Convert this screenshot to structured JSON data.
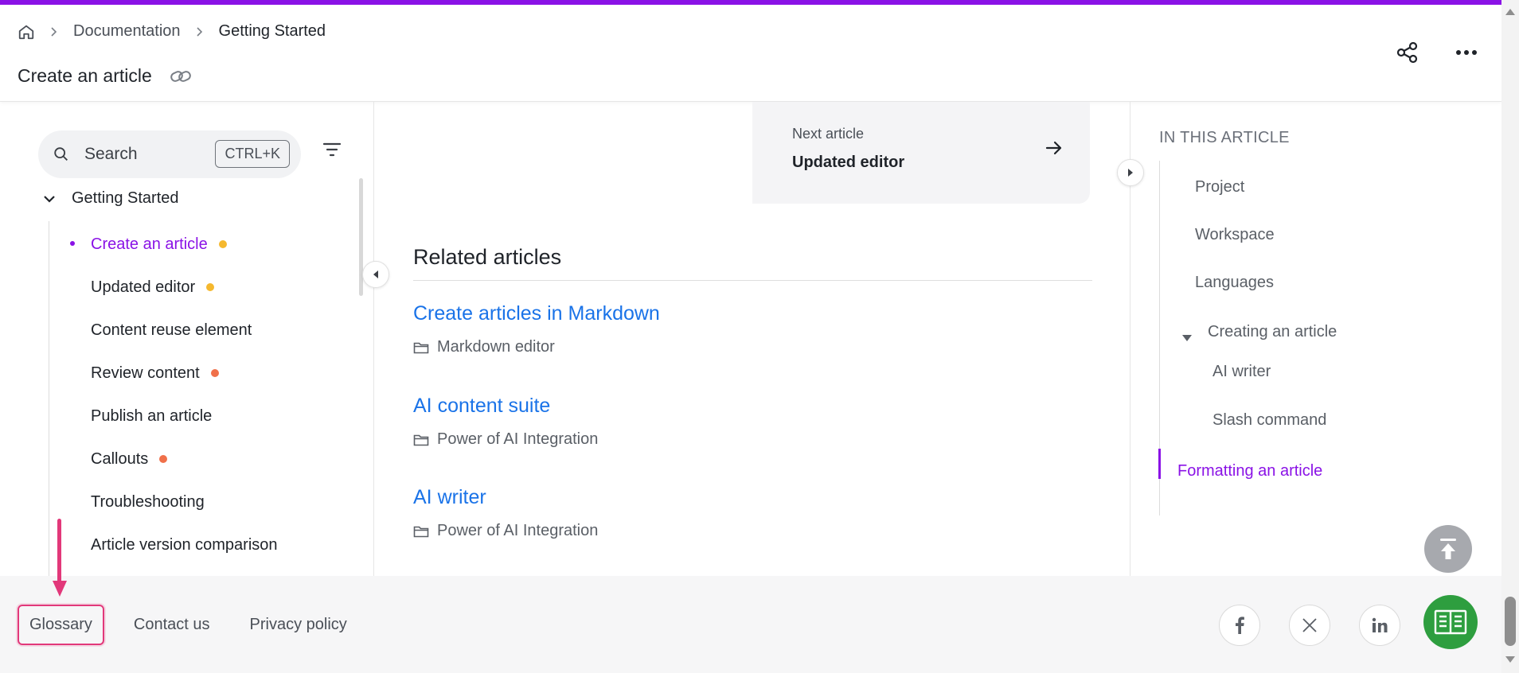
{
  "header": {
    "breadcrumbs": [
      "Documentation",
      "Getting Started"
    ],
    "title": "Create an article"
  },
  "sidebar": {
    "search_label": "Search",
    "search_shortcut": "CTRL+K",
    "section": "Getting Started",
    "items": [
      {
        "label": "Create an article",
        "active": true,
        "dot": "#f5b82e"
      },
      {
        "label": "Updated editor",
        "dot": "#f5b82e"
      },
      {
        "label": "Content reuse element"
      },
      {
        "label": "Review content",
        "dot": "#f0704a"
      },
      {
        "label": "Publish an article"
      },
      {
        "label": "Callouts",
        "dot": "#f0704a"
      },
      {
        "label": "Troubleshooting"
      },
      {
        "label": "Article version comparison"
      }
    ]
  },
  "main": {
    "next_article": {
      "kicker": "Next article",
      "title": "Updated editor"
    },
    "related_heading": "Related articles",
    "related": [
      {
        "title": "Create articles in Markdown",
        "category": "Markdown editor"
      },
      {
        "title": "AI content suite",
        "category": "Power of AI Integration"
      },
      {
        "title": "AI writer",
        "category": "Power of AI Integration"
      }
    ]
  },
  "toc": {
    "heading": "IN THIS ARTICLE",
    "items": [
      "Project",
      "Workspace",
      "Languages",
      "Creating an article",
      "AI writer",
      "Slash command",
      "Formatting an article"
    ]
  },
  "footer": {
    "links": [
      "Glossary",
      "Contact us",
      "Privacy policy"
    ],
    "social_icons": [
      "facebook-icon",
      "x-icon",
      "linkedin-icon"
    ]
  },
  "colors": {
    "accent": "#8a12e6",
    "link": "#1a73e8",
    "highlight": "#e2387a",
    "status_yellow": "#f5b82e",
    "status_orange": "#f0704a",
    "book_green": "#2e9e3f"
  }
}
